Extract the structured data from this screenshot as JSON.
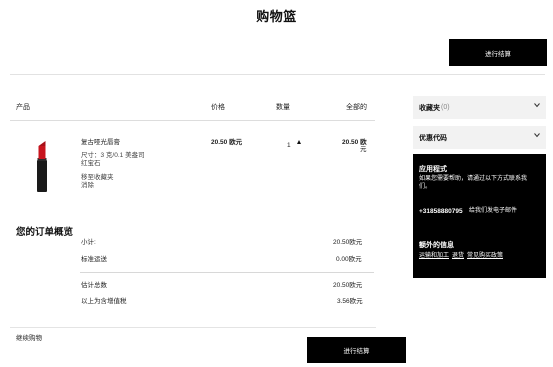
{
  "page": {
    "title": "购物篮"
  },
  "actions": {
    "checkout_label": "进行结算",
    "continue_shopping": "继续购物"
  },
  "cart": {
    "columns": {
      "product": "产品",
      "price": "价格",
      "quantity": "数量",
      "total": "全部的"
    },
    "item": {
      "name": "复古哑光唇膏",
      "size": "尺寸：3 克/0.1 美盎司",
      "shade": "红宝石",
      "move_to_favorites": "移至收藏夹",
      "remove": "消除",
      "price": "20.50 欧元",
      "quantity": "1",
      "total_line1": "20.50 欧",
      "total_line2": "元",
      "lipstick_color": "#c8141e"
    }
  },
  "summary": {
    "title": "您的订单概览",
    "subtotal_label": "小计:",
    "subtotal_value": "20.50欧元",
    "shipping_label": "标准运送",
    "shipping_value": "0.00欧元",
    "estimated_total_label": "估计总数",
    "estimated_total_value": "20.50欧元",
    "vat_label": "以上为含增值税",
    "vat_value": "3.56欧元"
  },
  "sidebar": {
    "favorites_label": "收藏夹",
    "favorites_count": "(0)",
    "promo_label": "优惠代码",
    "help_title": "应用程式",
    "help_text_1": "如果您需要帮助，请通过以下方式联系我",
    "help_text_2": "们。",
    "phone": "+31858880795",
    "email_link": "给我们发电子邮件",
    "extra_title": "额外的信息",
    "extra_link_1": "运输和加工",
    "extra_link_2": "退货",
    "extra_link_3": "常见购买政策"
  },
  "colors": {
    "accent": "#000000",
    "panel_bg": "#000000",
    "side_box_bg": "#f2f2f2"
  },
  "icons": {
    "chevron": "chevron-down-icon",
    "stepper": "triangle-up-icon"
  }
}
